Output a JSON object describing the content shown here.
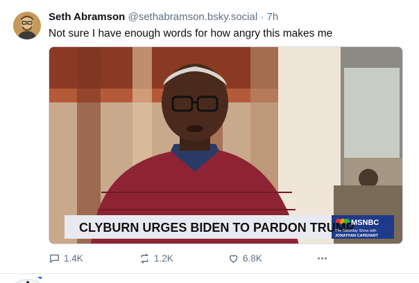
{
  "post": {
    "author_name": "Seth Abramson",
    "author_handle": "@sethabramson.bsky.social",
    "separator": "·",
    "time_ago": "7h",
    "text": "Not sure I have enough words for how angry this makes me",
    "avatar_icon": "person-portrait-icon",
    "media": {
      "chyron": "CLYBURN URGES BIDEN TO PARDON TRUMP",
      "network_logo": "MSNBC",
      "show_line1": "The Saturday Show with",
      "show_line2": "JONATHAN CAPEHART"
    },
    "actions": {
      "replies": "1.4K",
      "reposts": "1.2K",
      "likes": "6.8K",
      "more_icon": "more-horizontal-icon"
    }
  },
  "colors": {
    "muted_text": "#5b7083",
    "chyron_bg": "#e8eaf0",
    "network_bg": "#1f3a8a",
    "notification_dot": "#1d6ef5"
  }
}
